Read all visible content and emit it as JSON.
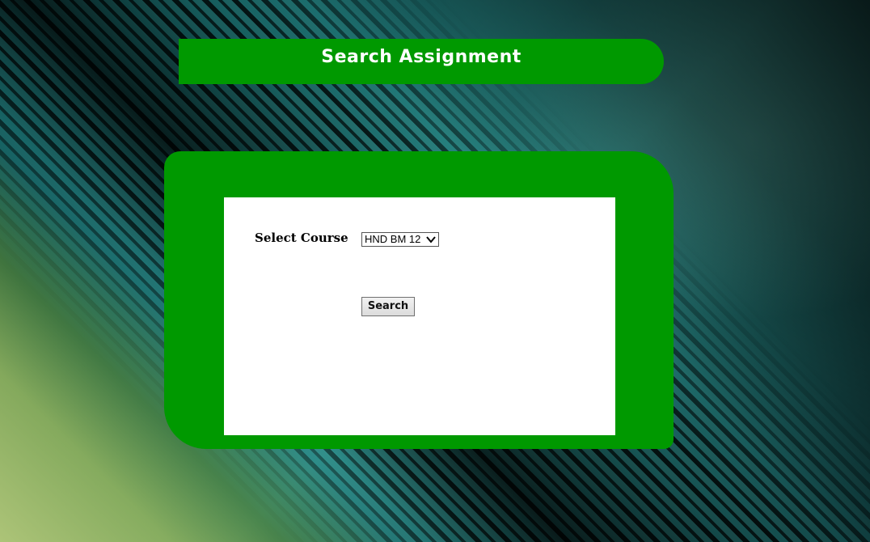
{
  "page": {
    "title": "Search Assignment"
  },
  "form": {
    "course_label": "Select Course",
    "course_selected": "HND BM 12",
    "search_label": "Search"
  },
  "colors": {
    "panel_green": "#009900",
    "form_background": "#ffffff",
    "title_text": "#ffffff"
  },
  "icons": {
    "select_arrow": "chevron-down-icon"
  }
}
